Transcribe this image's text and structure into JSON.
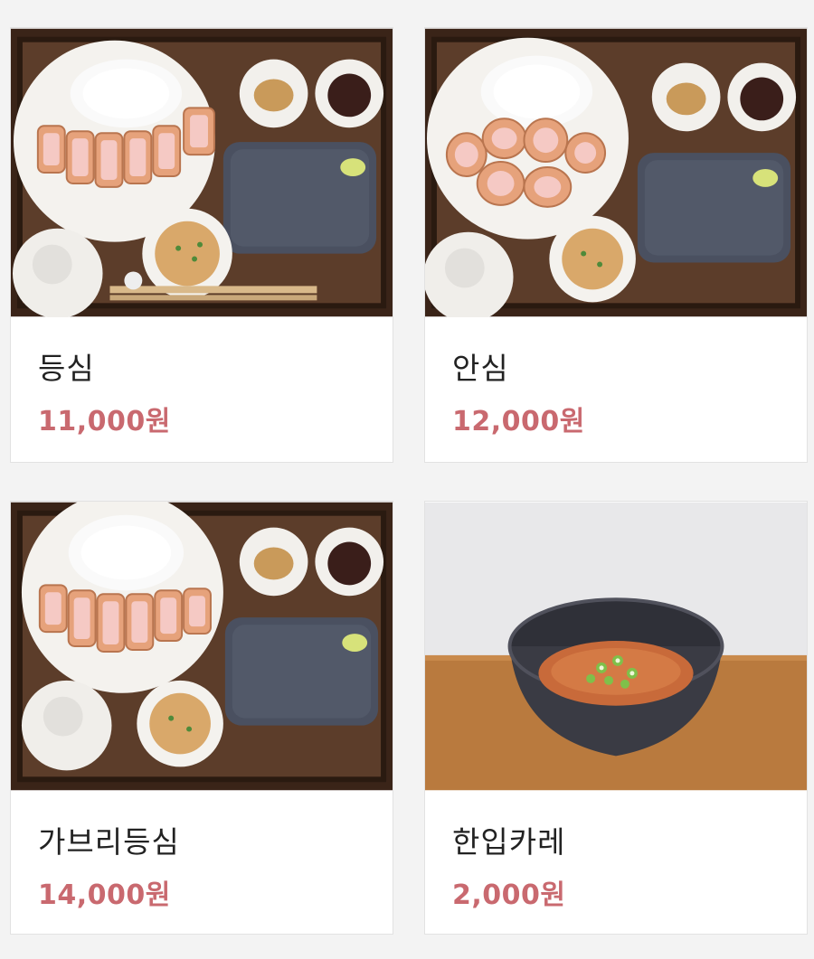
{
  "accent_price_color": "#c9696f",
  "menu": [
    {
      "name": "등심",
      "price": "11,000원",
      "photo": "tonkatsu-set-loin-photo"
    },
    {
      "name": "안심",
      "price": "12,000원",
      "photo": "tonkatsu-set-tenderloin-photo"
    },
    {
      "name": "가브리등심",
      "price": "14,000원",
      "photo": "tonkatsu-set-gabri-loin-photo"
    },
    {
      "name": "한입카레",
      "price": "2,000원",
      "photo": "curry-bowl-photo"
    }
  ]
}
